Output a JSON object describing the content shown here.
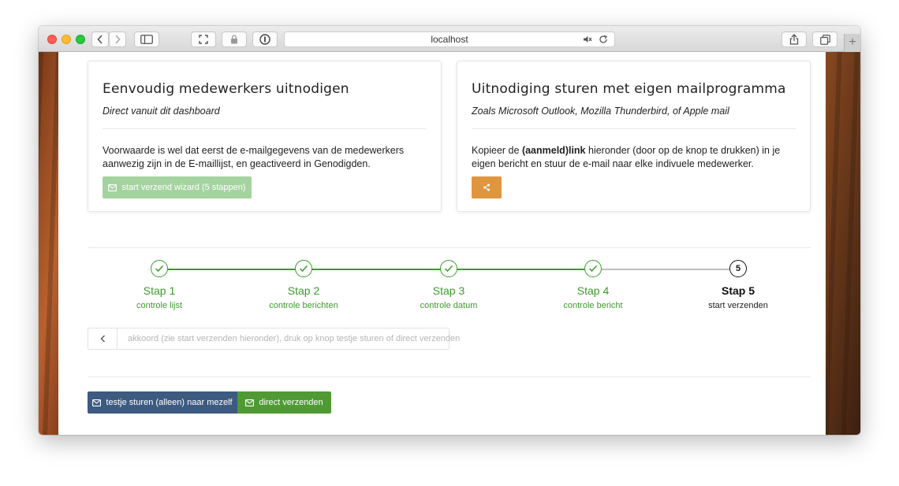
{
  "browser": {
    "url": "localhost",
    "new_tab_label": "+"
  },
  "cards": {
    "left": {
      "title": "Eenvoudig medewerkers uitnodigen",
      "subtitle": "Direct vanuit dit dashboard",
      "description": "Voorwaarde is wel dat eerst de e-mailgegevens van de medewerkers aanwezig zijn in de E-maillijst, en geactiveerd in Genodigden.",
      "button_label": "start verzend wizard (5 stappen)"
    },
    "right": {
      "title": "Uitnodiging sturen met eigen mailprogramma",
      "subtitle": "Zoals Microsoft Outlook, Mozilla Thunderbird, of Apple mail",
      "description_before": "Kopieer de ",
      "description_bold": "(aanmeld)link",
      "description_after": " hieronder (door op de knop te drukken) in je eigen bericht en stuur de e-mail naar elke indivuele medewerker."
    }
  },
  "stepper": {
    "steps": [
      {
        "title": "Stap 1",
        "caption": "controle lijst",
        "state": "done"
      },
      {
        "title": "Stap 2",
        "caption": "controle berichten",
        "state": "done"
      },
      {
        "title": "Stap 3",
        "caption": "controle datum",
        "state": "done"
      },
      {
        "title": "Stap 4",
        "caption": "controle bericht",
        "state": "done"
      },
      {
        "title": "Stap 5",
        "caption": "start verzenden",
        "state": "active",
        "number": "5"
      }
    ]
  },
  "notice": {
    "message": "akkoord (zie start verzenden hieronder), druk op knop testje sturen of direct verzenden"
  },
  "actions": {
    "test_label": "testje sturen (alleen) naar mezelf",
    "send_label": "direct verzenden"
  },
  "colors": {
    "success": "#3e9a2f",
    "wizard_button": "#a4d3a0",
    "share_button": "#e0963f",
    "test_button": "#3d5a80",
    "send_button": "#4f9a35"
  }
}
